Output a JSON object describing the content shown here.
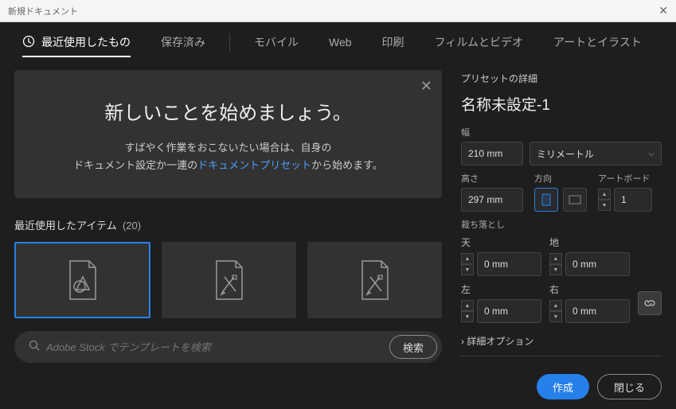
{
  "window": {
    "title": "新規ドキュメント"
  },
  "tabs": {
    "recent": "最近使用したもの",
    "saved": "保存済み",
    "mobile": "モバイル",
    "web": "Web",
    "print": "印刷",
    "film": "フィルムとビデオ",
    "art": "アートとイラスト"
  },
  "hero": {
    "title": "新しいことを始めましょう。",
    "line1_a": "すばやく作業をおこないたい場合は、自身の",
    "line2_a": "ドキュメント設定か一連の",
    "link": "ドキュメントプリセット",
    "line3": "から始めます。"
  },
  "recent": {
    "label": "最近使用したアイテム",
    "count": "(20)"
  },
  "search": {
    "placeholder": "Adobe Stock でテンプレートを検索",
    "button": "検索"
  },
  "details": {
    "header": "プリセットの詳細",
    "docname": "名称未設定-1",
    "width_label": "幅",
    "width_value": "210 mm",
    "unit": "ミリメートル",
    "height_label": "高さ",
    "height_value": "297 mm",
    "orient_label": "方向",
    "artboard_label": "アートボード",
    "artboard_value": "1",
    "bleed_label": "裁ち落とし",
    "top_label": "天",
    "bottom_label": "地",
    "left_label": "左",
    "right_label": "右",
    "bleed_top": "0 mm",
    "bleed_bottom": "0 mm",
    "bleed_left": "0 mm",
    "bleed_right": "0 mm",
    "advanced": "詳細オプション"
  },
  "footer": {
    "create": "作成",
    "close": "閉じる"
  }
}
